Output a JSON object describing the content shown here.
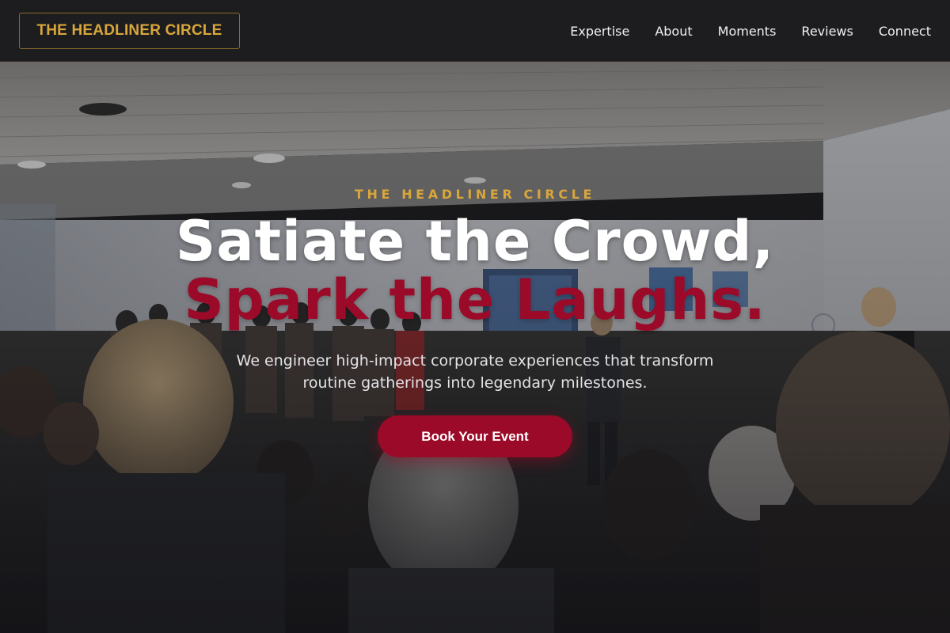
{
  "header": {
    "brand": "THE HEADLINER CIRCLE",
    "nav": [
      {
        "label": "Expertise"
      },
      {
        "label": "About"
      },
      {
        "label": "Moments"
      },
      {
        "label": "Reviews"
      },
      {
        "label": "Connect"
      }
    ]
  },
  "hero": {
    "eyebrow": "THE HEADLINER CIRCLE",
    "headline_line1": "Satiate the Crowd,",
    "headline_line2": "Spark the Laughs.",
    "subtext": "We engineer high-impact corporate experiences that transform routine gatherings into legendary milestones.",
    "cta_label": "Book Your Event"
  },
  "colors": {
    "accent_gold": "#d9a63b",
    "accent_crimson": "#9b0a28",
    "header_bg": "#1d1d1f",
    "text_light": "#f1f1f1"
  },
  "icons": {
    "hero_background": "conference-crowd-photo"
  }
}
